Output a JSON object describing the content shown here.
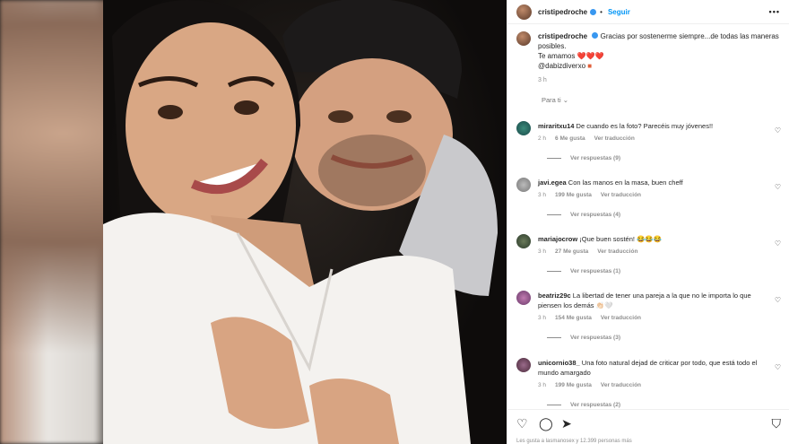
{
  "post": {
    "username": "cristipedroche",
    "follow_label": "Seguir",
    "more_label": "•••",
    "caption_user": "cristipedroche",
    "caption_text": "Gracias por sostenerme siempre...de todas las maneras posibles.",
    "caption_line2": "Te amamos",
    "caption_hearts": "❤️❤️❤️",
    "caption_mention": "@dabizdiverxo",
    "caption_time": "3 h",
    "for_you_label": "Para ti"
  },
  "comments": [
    {
      "user": "miraritxu14",
      "text": "De cuando es la foto? Parecéis muy jóvenes!!",
      "time": "2 h",
      "likes": "6 Me gusta",
      "translate": "Ver traducción",
      "replies": "Ver respuestas (9)"
    },
    {
      "user": "javi.egea",
      "text": "Con las manos en la masa, buen cheff",
      "time": "3 h",
      "likes": "199 Me gusta",
      "translate": "Ver traducción",
      "replies": "Ver respuestas (4)"
    },
    {
      "user": "mariajocrow",
      "text": "¡Que buen sostén! 😂😂😂",
      "time": "3 h",
      "likes": "27 Me gusta",
      "translate": "Ver traducción",
      "replies": "Ver respuestas (1)"
    },
    {
      "user": "beatriz29c",
      "text": "La libertad de tener una pareja a la que no le importa lo que piensen los demás 👏🏻🤍",
      "time": "3 h",
      "likes": "154 Me gusta",
      "translate": "Ver traducción",
      "replies": "Ver respuestas (3)"
    },
    {
      "user": "unicornio38_",
      "text": "Una foto natural dejad de criticar por todo, que está todo el mundo amargado",
      "time": "3 h",
      "likes": "199 Me gusta",
      "translate": "Ver traducción",
      "replies": "Ver respuestas (2)"
    }
  ],
  "footer": {
    "likes_text": "Les gusta a lasmanosex y 12.399 personas más"
  },
  "icons": {
    "like": "heart-icon",
    "comment": "comment-icon",
    "share": "share-icon",
    "save": "bookmark-icon"
  }
}
